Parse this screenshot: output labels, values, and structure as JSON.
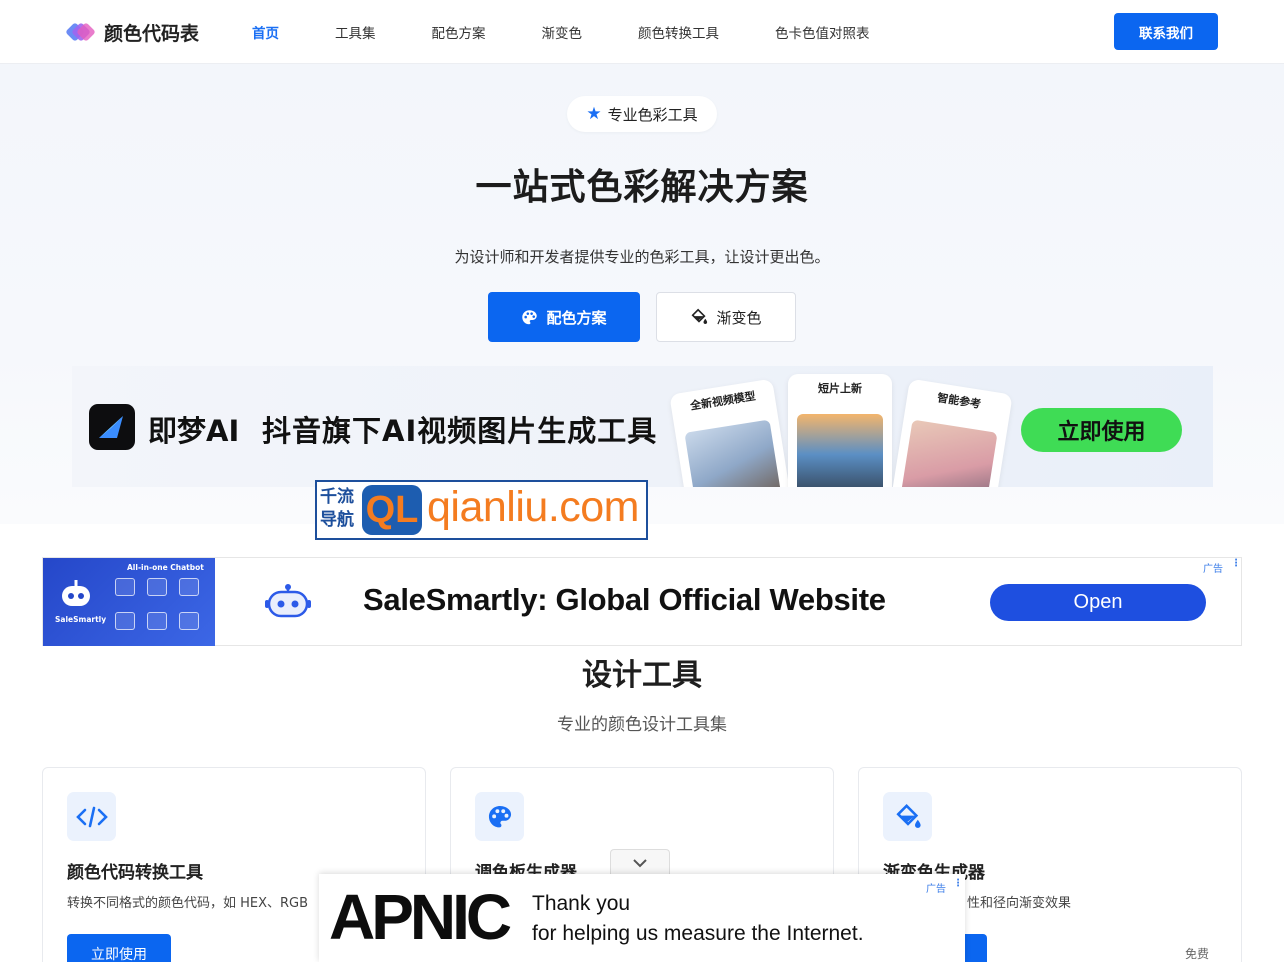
{
  "nav": {
    "logo_text": "颜色代码表",
    "links": [
      "首页",
      "工具集",
      "配色方案",
      "渐变色",
      "颜色转换工具",
      "色卡色值对照表"
    ],
    "contact_label": "联系我们"
  },
  "hero": {
    "pill_label": "专业色彩工具",
    "title": "一站式色彩解决方案",
    "subtitle": "为设计师和开发者提供专业的色彩工具，让设计更出色。",
    "primary_label": "配色方案",
    "secondary_label": "渐变色"
  },
  "banner": {
    "brand": "即梦AI",
    "desc": "抖音旗下AI视频图片生成工具",
    "cards": [
      "全新视频模型",
      "短片上新",
      "智能参考"
    ],
    "cta": "立即使用"
  },
  "qianliu": {
    "cn_line1": "千流",
    "cn_line2": "导航",
    "badge": "QL",
    "url": "qianliu.com"
  },
  "ad1": {
    "thumb_title": "All-in-one Chatbot",
    "thumb_brand": "SaleSmartly",
    "title": "SaleSmartly: Global Official Website",
    "open_label": "Open",
    "tag": "广告"
  },
  "tools": {
    "title": "设计工具",
    "subtitle": "专业的颜色设计工具集",
    "items": [
      {
        "title": "颜色代码转换工具",
        "desc": "转换不同格式的颜色代码，如 HEX、RGB",
        "button": "立即使用",
        "icon": "code-icon"
      },
      {
        "title": "调色板生成器",
        "desc": "",
        "button": "",
        "icon": "palette-icon"
      },
      {
        "title": "渐变色生成器",
        "desc": "性和径向渐变效果",
        "button": "",
        "badge": "免费",
        "icon": "paint-bucket-icon"
      }
    ]
  },
  "ad2": {
    "logo": "APNIC",
    "line1": "Thank you",
    "line2": "for helping us measure the Internet.",
    "tag": "广告"
  },
  "colors": {
    "accent": "#0b66f0",
    "banner_cta": "#3fdc55",
    "qianliu_orange": "#f47c20",
    "qianliu_blue": "#1d4f9c",
    "ad_open": "#1e4fe0"
  }
}
